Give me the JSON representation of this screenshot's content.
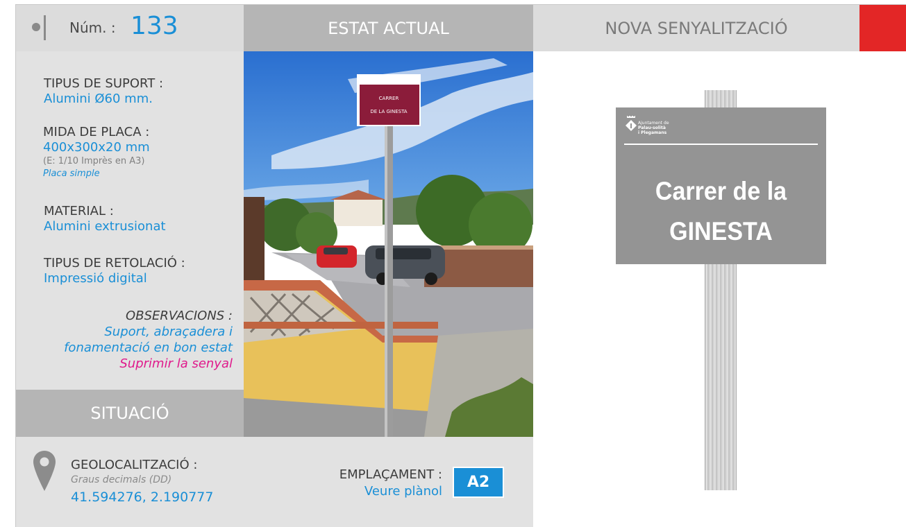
{
  "header": {
    "num_label": "Núm. :",
    "num_value": "133",
    "estat": "ESTAT ACTUAL",
    "nova": "NOVA SENYALITZACIÓ",
    "accent_color": "#e32626"
  },
  "info": {
    "suport_label": "TIPUS DE SUPORT :",
    "suport_value": "Alumini Ø60 mm.",
    "mida_label": "MIDA DE PLACA :",
    "mida_value": "400x300x20 mm",
    "mida_scale": "(E: 1/10 Imprès en A3)",
    "mida_note": "Placa simple",
    "material_label": "MATERIAL :",
    "material_value": "Alumini extrusionat",
    "retolacio_label": "TIPUS DE RETOLACIÓ :",
    "retolacio_value": "Impressió digital",
    "obs_label": "OBSERVACIONS :",
    "obs_line1": "Suport, abraçadera i",
    "obs_line2": "fonamentació en bon estat",
    "obs_line3": "Suprimir la senyal"
  },
  "situacio": {
    "title": "SITUACIÓ",
    "geo_label": "GEOLOCALITZACIÓ :",
    "geo_sub": "Graus decimals (DD)",
    "geo_value": "41.594276, 2.190777",
    "emp_label": "EMPLAÇAMENT :",
    "emp_value": "Veure plànol",
    "emp_badge": "A2"
  },
  "photo": {
    "sign_line1": "CARRER",
    "sign_line2": "DE LA GINESTA"
  },
  "new_sign": {
    "logo_line1": "Ajuntament de",
    "logo_line2": "Palau-solità",
    "logo_line3": "i Plegamans",
    "title_line1": "Carrer de la",
    "title_line2": "GINESTA",
    "plate_color": "#949494"
  },
  "icons": [
    "map-pin-icon",
    "municipal-crest-icon"
  ]
}
